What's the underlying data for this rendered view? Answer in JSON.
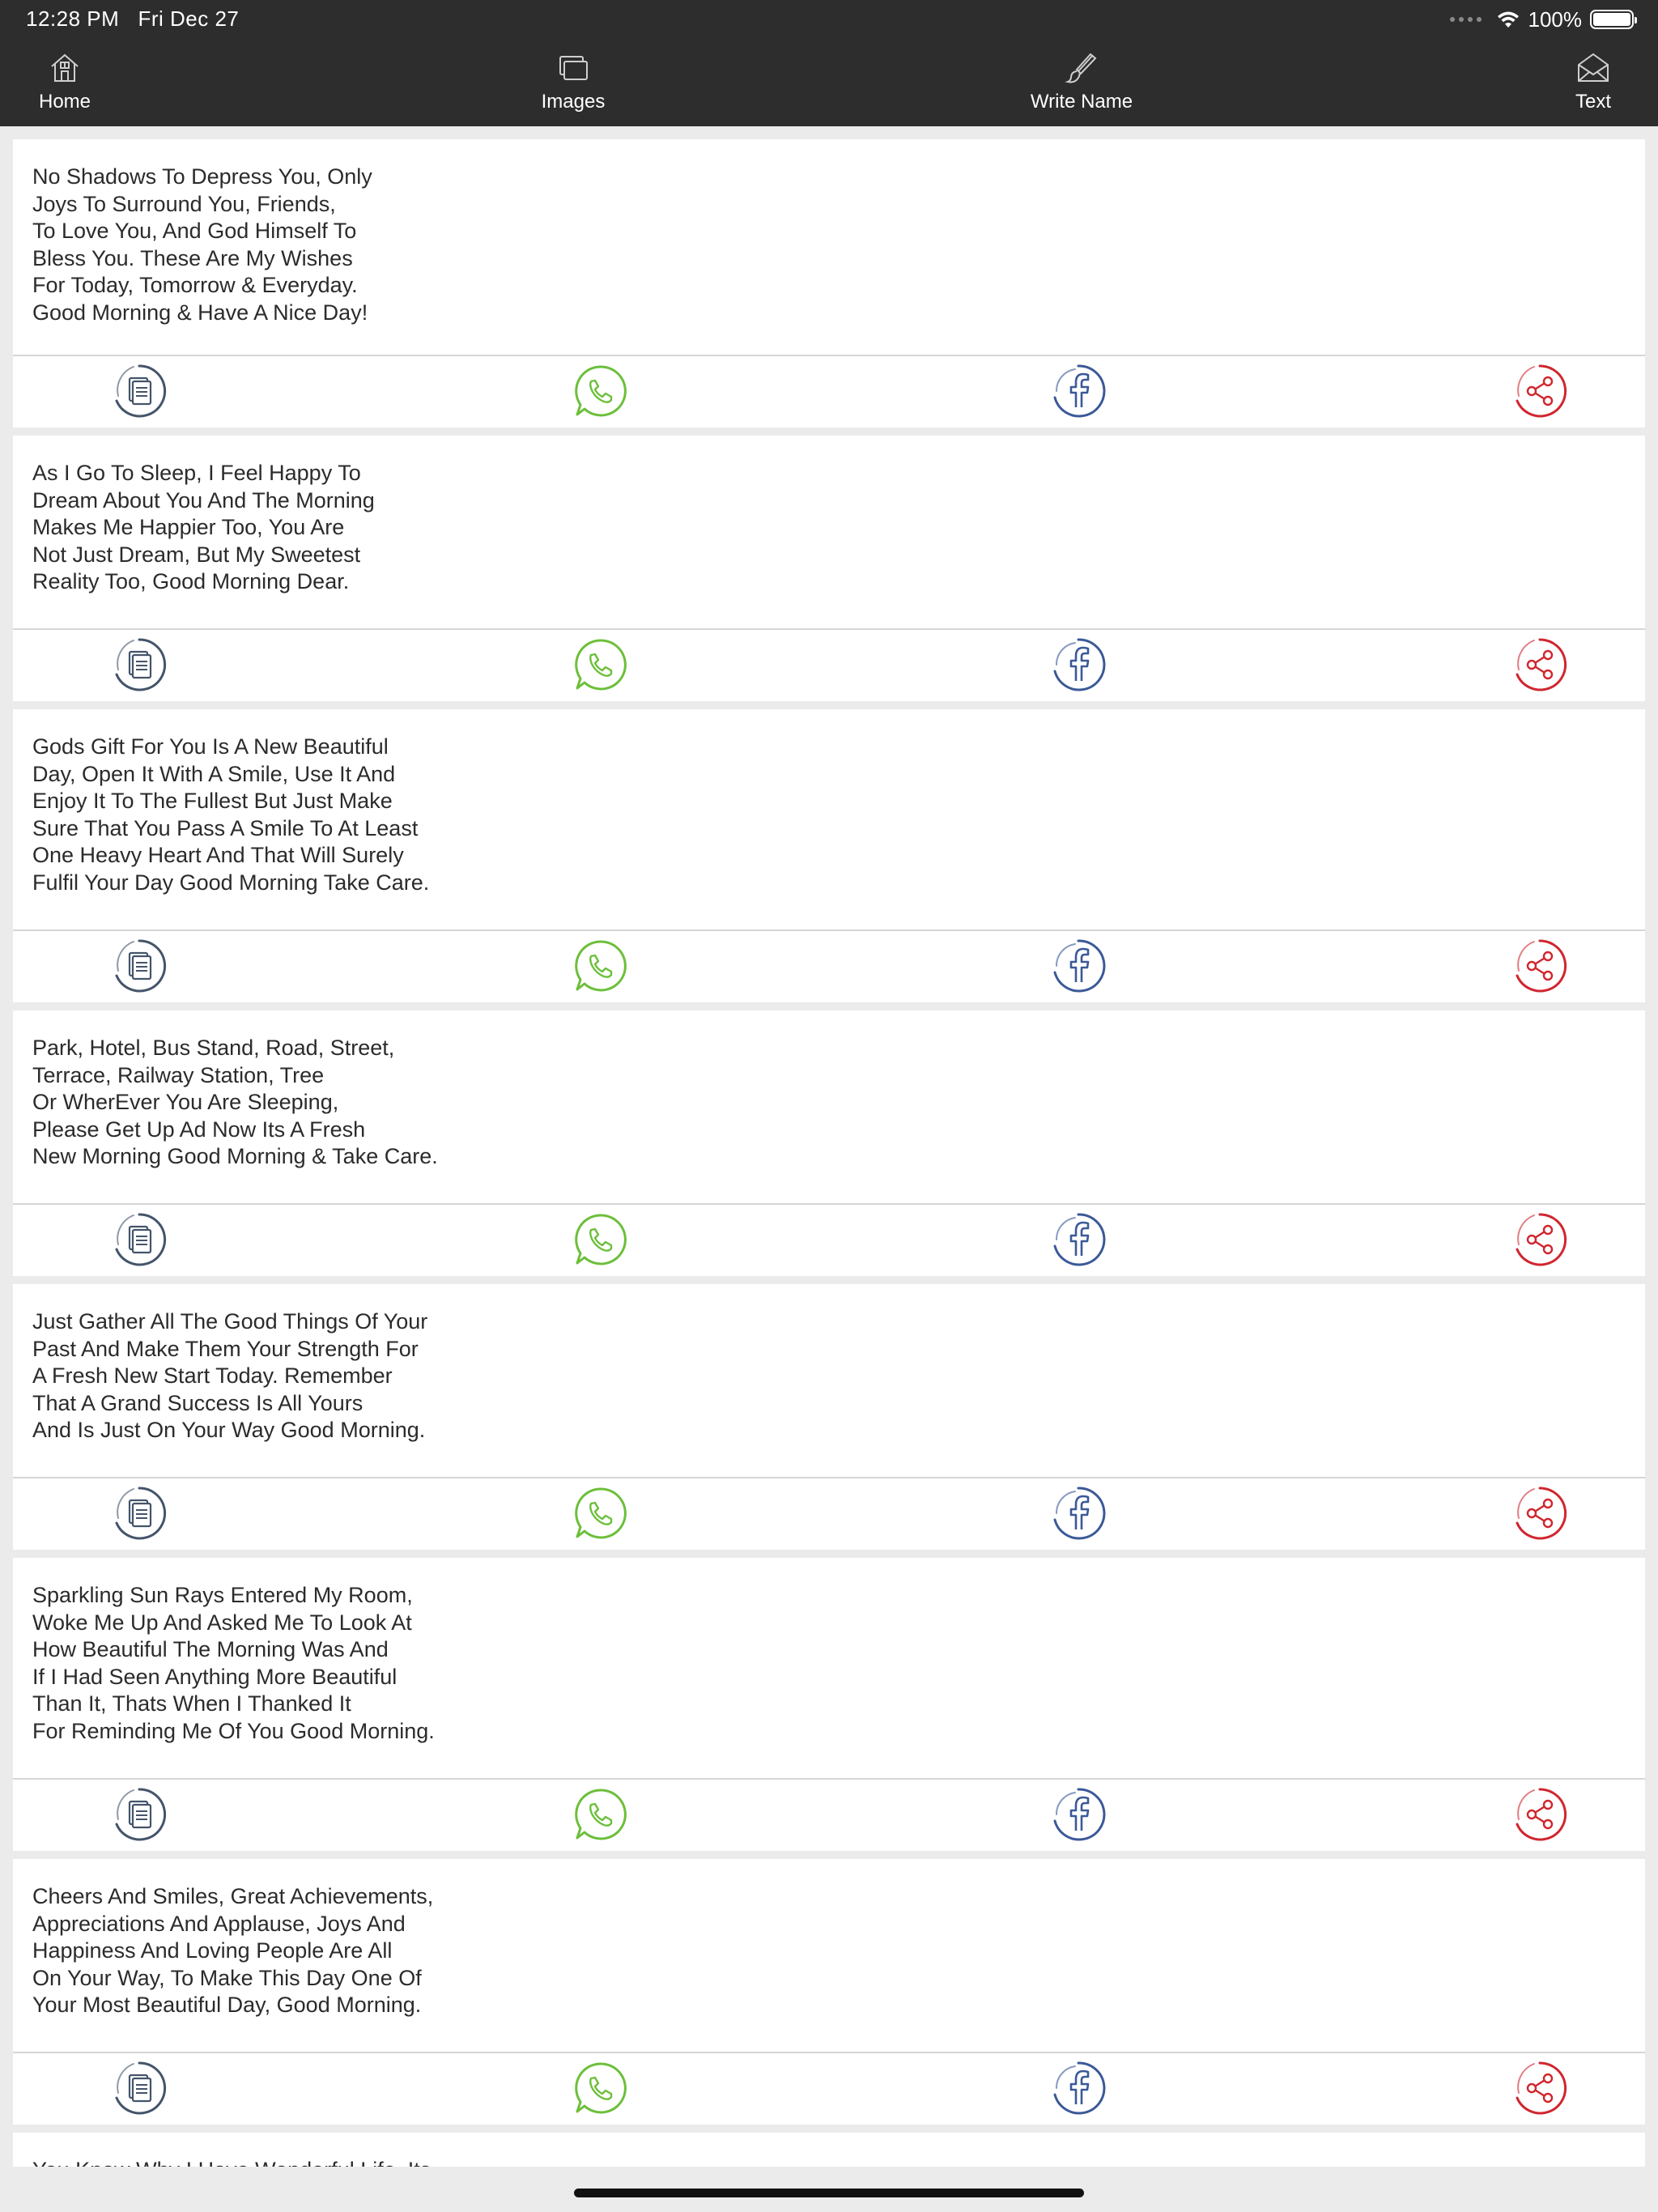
{
  "status_bar": {
    "time": "12:28 PM",
    "date": "Fri Dec 27",
    "battery": "100%",
    "battery_level": 1.0,
    "icons": [
      "signal-dots-icon",
      "wifi-icon",
      "battery-icon"
    ]
  },
  "nav": {
    "home": {
      "label": "Home",
      "icon": "home-icon"
    },
    "images": {
      "label": "Images",
      "icon": "images-icon"
    },
    "write_name": {
      "label": "Write Name",
      "icon": "brush-icon"
    },
    "text": {
      "label": "Text",
      "icon": "envelope-icon"
    }
  },
  "actions": {
    "copy": {
      "icon": "copy-icon",
      "color": "#44546a"
    },
    "whatsapp": {
      "icon": "whatsapp-icon",
      "color": "#6cbf3a"
    },
    "facebook": {
      "icon": "facebook-icon",
      "color": "#3b5998"
    },
    "share": {
      "icon": "share-icon",
      "color": "#d0262f"
    }
  },
  "colors": {
    "topbar": "#2d2d2d",
    "background": "#ebebeb",
    "card": "#ffffff",
    "text": "#2b2b2b"
  },
  "messages": [
    {
      "text": "No Shadows To Depress You, Only\nJoys To Surround You, Friends,\nTo Love You, And God Himself To\nBless You. These Are My Wishes\nFor Today, Tomorrow & Everyday.\nGood Morning & Have A Nice Day!"
    },
    {
      "text": "As I Go To Sleep, I Feel Happy To\nDream About You And The Morning\nMakes Me Happier Too, You Are\nNot Just Dream, But My Sweetest\nReality Too, Good Morning Dear."
    },
    {
      "text": "Gods Gift For You Is A New Beautiful\nDay, Open It With A Smile, Use It And\nEnjoy It To The Fullest But Just Make\nSure That You Pass A Smile To At Least\nOne Heavy Heart And That Will Surely\nFulfil Your Day Good Morning Take Care."
    },
    {
      "text": "Park, Hotel, Bus Stand, Road, Street,\nTerrace, Railway Station, Tree\nOr WherEver You Are Sleeping,\nPlease Get Up Ad Now Its A Fresh\nNew Morning Good Morning & Take Care."
    },
    {
      "text": "Just Gather All The Good Things Of Your\nPast And Make Them Your Strength For\nA Fresh New Start Today. Remember\nThat A Grand Success Is All Yours\nAnd Is Just On Your Way Good Morning."
    },
    {
      "text": "Sparkling Sun Rays Entered My Room,\nWoke Me Up And Asked Me To Look At\nHow Beautiful The Morning Was And\nIf I Had Seen Anything More Beautiful\nThan It, Thats When I Thanked It\nFor Reminding Me Of You Good Morning."
    },
    {
      "text": "Cheers And Smiles, Great Achievements,\nAppreciations And Applause, Joys And\nHappiness And Loving People Are All\nOn Your Way, To Make This Day One Of\nYour Most Beautiful Day, Good Morning."
    },
    {
      "text": "You Know Why I Have Wonderful Life, Its\nAll Because Of My Wife, You Changes\nMy Fate, Brought In My Life, Love\nHappiness, Charm, Joy And All The"
    }
  ]
}
